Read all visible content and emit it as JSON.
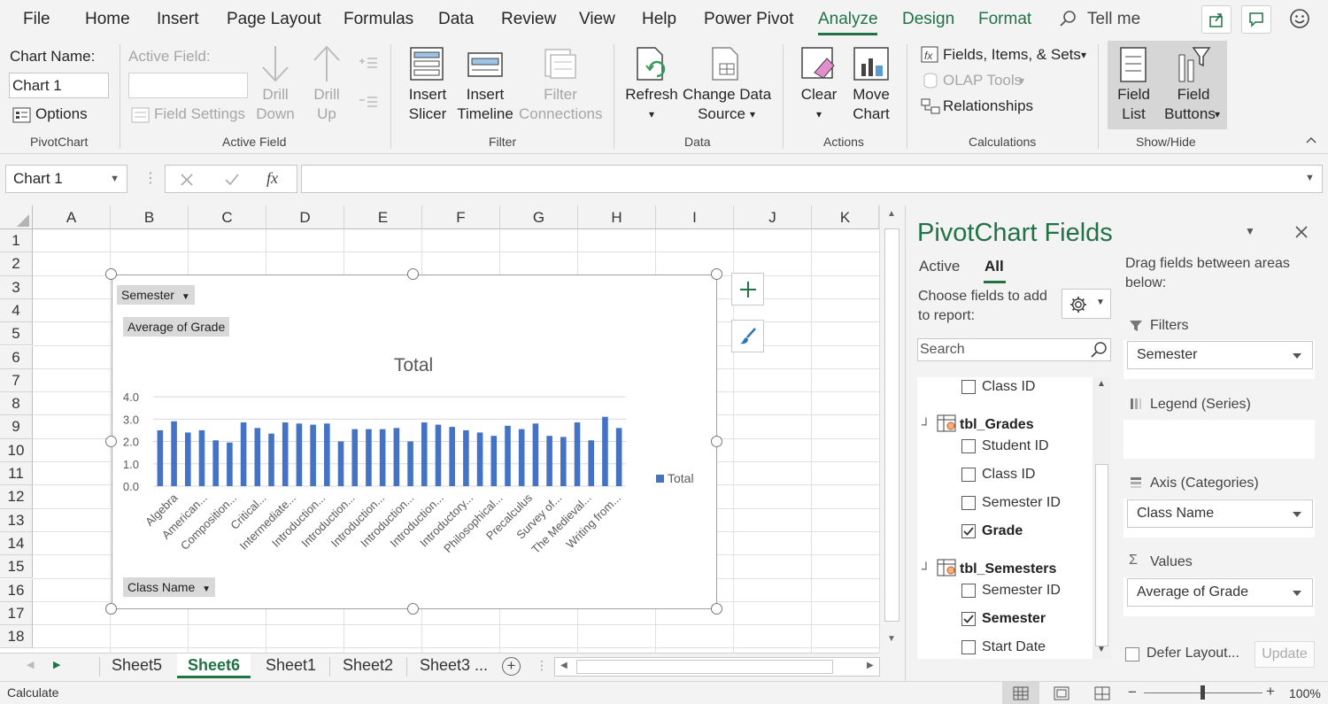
{
  "menu": {
    "items": [
      "File",
      "Home",
      "Insert",
      "Page Layout",
      "Formulas",
      "Data",
      "Review",
      "View",
      "Help",
      "Power Pivot"
    ],
    "context_tabs": [
      "Analyze",
      "Design",
      "Format"
    ],
    "tell_me": "Tell me"
  },
  "ribbon": {
    "pivotchart": {
      "chart_name_label": "Chart Name:",
      "chart_name_value": "Chart 1",
      "options": "Options",
      "group": "PivotChart"
    },
    "active_field": {
      "label": "Active Field:",
      "field_settings": "Field Settings",
      "drill_down": [
        "Drill",
        "Down"
      ],
      "drill_up": [
        "Drill",
        "Up"
      ],
      "group": "Active Field"
    },
    "filter": {
      "insert_slicer": [
        "Insert",
        "Slicer"
      ],
      "insert_timeline": [
        "Insert",
        "Timeline"
      ],
      "filter_connections": [
        "Filter",
        "Connections"
      ],
      "group": "Filter"
    },
    "data": {
      "refresh": "Refresh",
      "change_source": [
        "Change Data",
        "Source"
      ],
      "group": "Data"
    },
    "actions": {
      "clear": "Clear",
      "move_chart": [
        "Move",
        "Chart"
      ],
      "group": "Actions"
    },
    "calculations": {
      "fields_items_sets": "Fields, Items, & Sets",
      "olap_tools": "OLAP Tools",
      "relationships": "Relationships",
      "group": "Calculations"
    },
    "showhide": {
      "field_list": [
        "Field",
        "List"
      ],
      "field_buttons": [
        "Field",
        "Buttons"
      ],
      "group": "Show/Hide"
    }
  },
  "formula_bar": {
    "name_box": "Chart 1",
    "fx": "fx",
    "content": ""
  },
  "grid": {
    "columns": [
      "A",
      "B",
      "C",
      "D",
      "E",
      "F",
      "G",
      "H",
      "I",
      "J",
      "K"
    ],
    "rows": [
      "1",
      "2",
      "3",
      "4",
      "5",
      "6",
      "7",
      "8",
      "9",
      "10",
      "11",
      "12",
      "13",
      "14",
      "15",
      "16",
      "17",
      "18"
    ]
  },
  "chart_buttons": {
    "semester": "Semester",
    "average": "Average of Grade",
    "class_name": "Class Name"
  },
  "chart_data": {
    "type": "bar",
    "title": "Total",
    "ylim": [
      0,
      4.0
    ],
    "yticks": [
      "0.0",
      "1.0",
      "2.0",
      "3.0",
      "4.0"
    ],
    "legend": "Total",
    "legend_position": "right",
    "color": "#4472c4",
    "categories_shown": [
      "Algebra",
      "American...",
      "Composition...",
      "Critical...",
      "Intermediate...",
      "Introduction...",
      "Introduction...",
      "Introduction...",
      "Introduction...",
      "Introduction...",
      "Introductory...",
      "Philosophical...",
      "Precalculus",
      "Survey of...",
      "The Medieval...",
      "Writing from..."
    ],
    "values": [
      2.5,
      2.9,
      2.4,
      2.5,
      2.05,
      1.95,
      2.85,
      2.6,
      2.35,
      2.85,
      2.8,
      2.75,
      2.8,
      2.0,
      2.55,
      2.55,
      2.55,
      2.6,
      2.0,
      2.85,
      2.75,
      2.65,
      2.5,
      2.4,
      2.25,
      2.7,
      2.55,
      2.8,
      2.25,
      2.2,
      2.85,
      2.05,
      3.1,
      2.6
    ]
  },
  "sheets": {
    "tabs": [
      "Sheet5",
      "Sheet6",
      "Sheet1",
      "Sheet2",
      "Sheet3 ..."
    ],
    "active": "Sheet6"
  },
  "status": {
    "left": "Calculate",
    "zoom": "100%"
  },
  "pane": {
    "title": "PivotChart Fields",
    "tab_active": "Active",
    "tab_all": "All",
    "choose": "Choose fields to add to report:",
    "search_placeholder": "Search",
    "fields": {
      "class_id_top": "Class ID",
      "tbl_grades": "tbl_Grades",
      "student_id": "Student ID",
      "class_id": "Class ID",
      "semester_id": "Semester ID",
      "grade": "Grade",
      "tbl_semesters": "tbl_Semesters",
      "semester_id2": "Semester ID",
      "semester": "Semester",
      "start_date": "Start Date"
    },
    "drag_hint": "Drag fields between areas below:",
    "areas": {
      "filters": "Filters",
      "filters_value": "Semester",
      "legend": "Legend (Series)",
      "axis": "Axis (Categories)",
      "axis_value": "Class Name",
      "values": "Values",
      "values_value": "Average of Grade"
    },
    "defer": "Defer Layout...",
    "update": "Update"
  }
}
